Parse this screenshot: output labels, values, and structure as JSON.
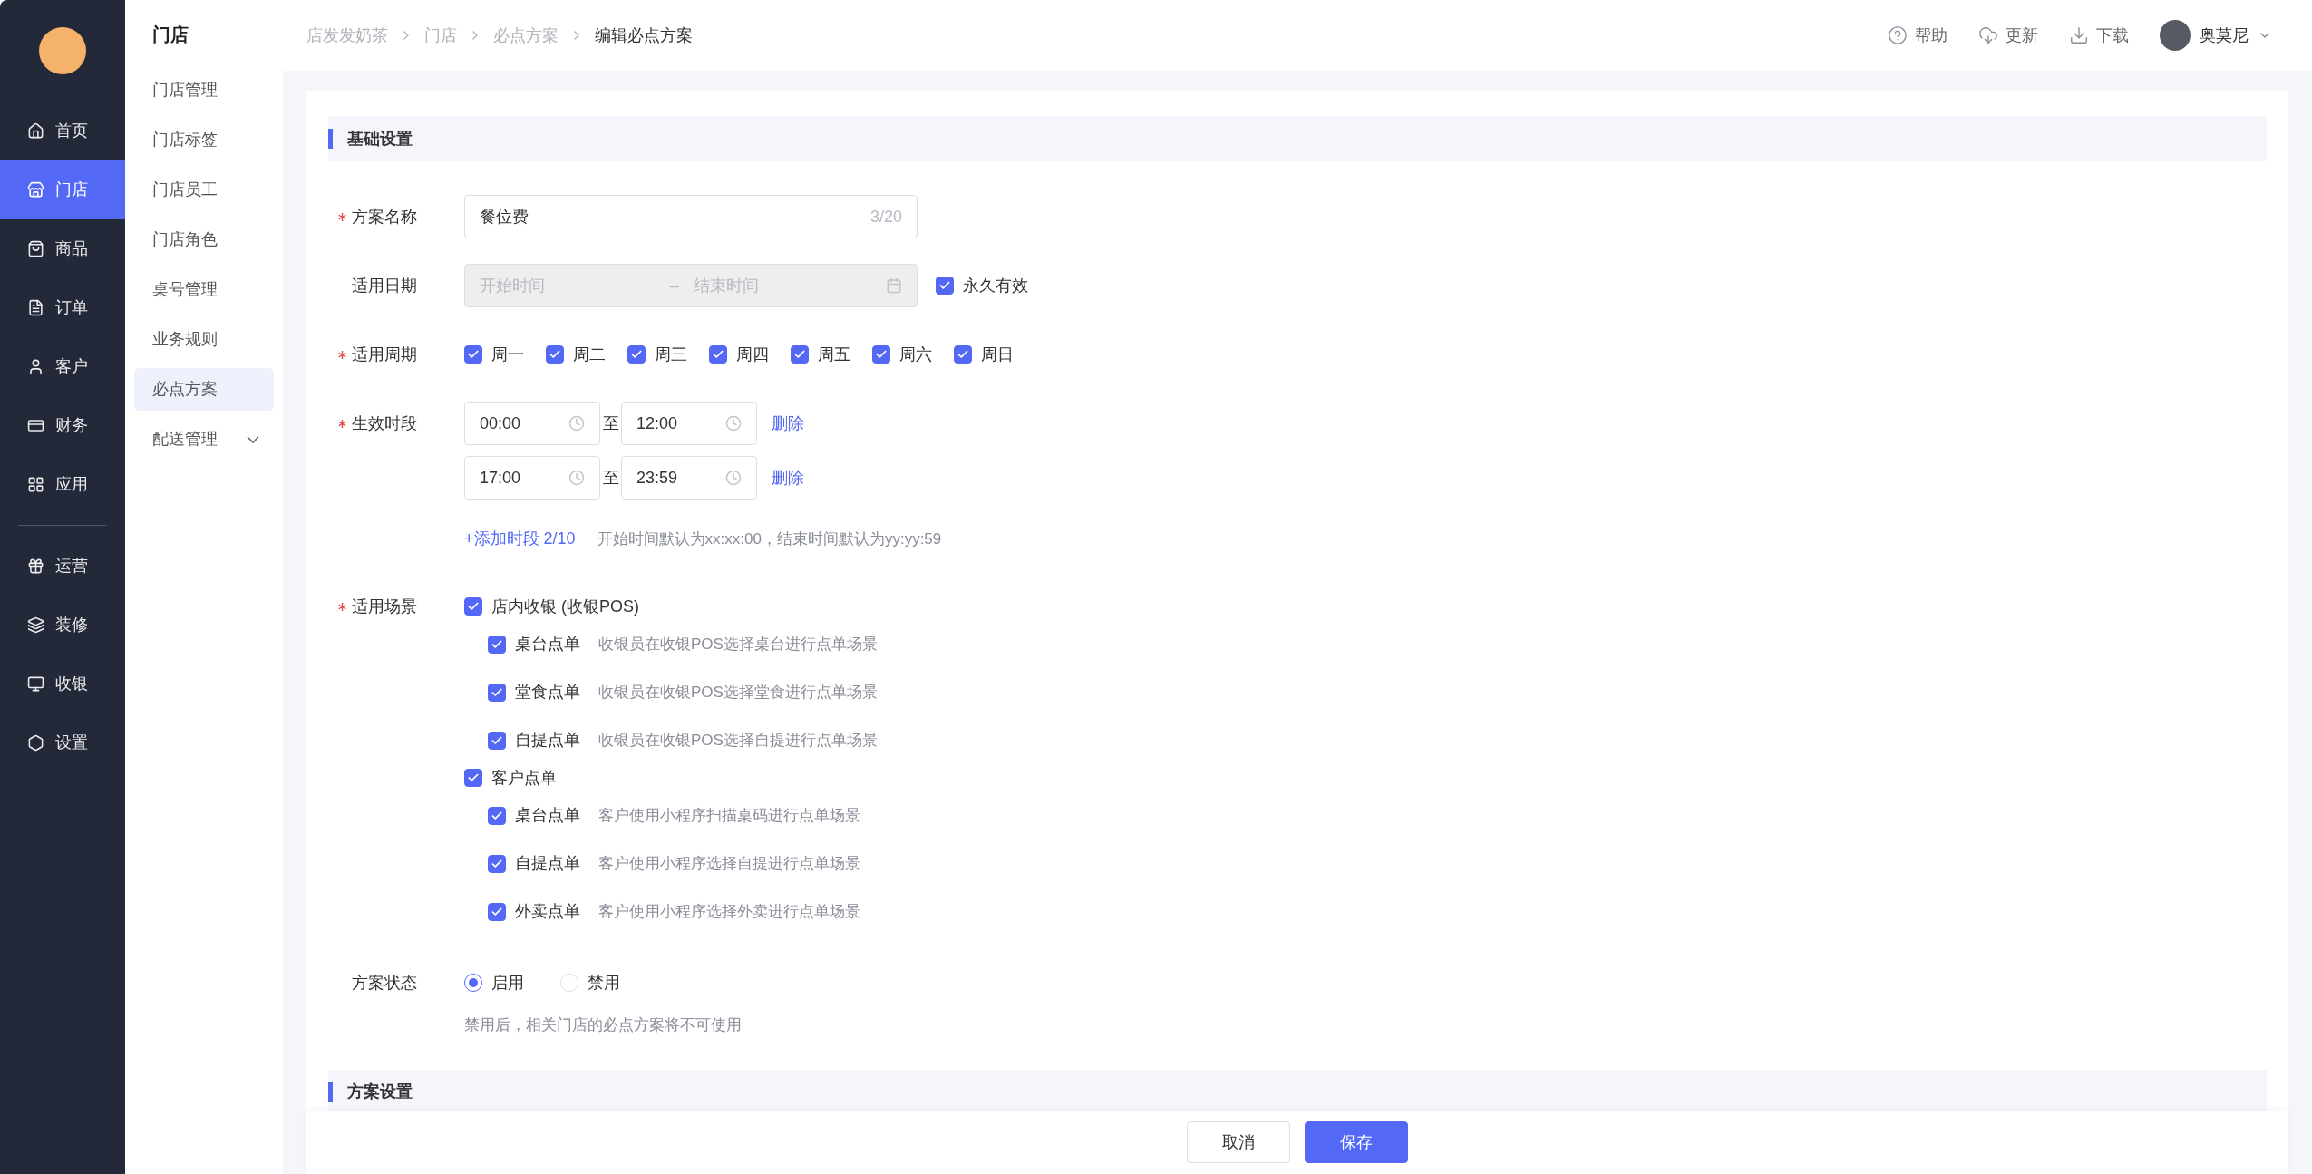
{
  "sidebar": {
    "main_items": [
      {
        "label": "首页",
        "selected": false
      },
      {
        "label": "门店",
        "selected": true
      },
      {
        "label": "商品",
        "selected": false
      },
      {
        "label": "订单",
        "selected": false
      },
      {
        "label": "客户",
        "selected": false
      },
      {
        "label": "财务",
        "selected": false
      },
      {
        "label": "应用",
        "selected": false
      }
    ],
    "tool_items": [
      {
        "label": "运营",
        "selected": false
      },
      {
        "label": "装修",
        "selected": false
      },
      {
        "label": "收银",
        "selected": false
      },
      {
        "label": "设置",
        "selected": false
      }
    ]
  },
  "submenu": {
    "title": "门店",
    "items": [
      {
        "label": "门店管理",
        "selected": false,
        "has_children": false
      },
      {
        "label": "门店标签",
        "selected": false,
        "has_children": false
      },
      {
        "label": "门店员工",
        "selected": false,
        "has_children": false
      },
      {
        "label": "门店角色",
        "selected": false,
        "has_children": false
      },
      {
        "label": "桌号管理",
        "selected": false,
        "has_children": false
      },
      {
        "label": "业务规则",
        "selected": false,
        "has_children": false
      },
      {
        "label": "必点方案",
        "selected": true,
        "has_children": false
      },
      {
        "label": "配送管理",
        "selected": false,
        "has_children": true
      }
    ]
  },
  "topbar": {
    "breadcrumb": [
      "店发发奶茶",
      "门店",
      "必点方案",
      "编辑必点方案"
    ],
    "actions": [
      {
        "label": "帮助"
      },
      {
        "label": "更新"
      },
      {
        "label": "下载"
      }
    ],
    "user": {
      "name": "奥莫尼"
    }
  },
  "sections": [
    {
      "title": "基础设置",
      "fields": [
        {
          "kind": "text",
          "label": "方案名称",
          "required": true,
          "value": "餐位费",
          "counter": "3/20"
        },
        {
          "kind": "daterange",
          "label": "适用日期",
          "required": false,
          "disabled": true,
          "start_placeholder": "开始时间",
          "separator": "–",
          "end_placeholder": "结束时间",
          "option": {
            "label": "永久有效",
            "checked": true
          }
        },
        {
          "kind": "checkboxes",
          "label": "适用周期",
          "required": true,
          "options": [
            {
              "label": "周一",
              "checked": true
            },
            {
              "label": "周二",
              "checked": true
            },
            {
              "label": "周三",
              "checked": true
            },
            {
              "label": "周四",
              "checked": true
            },
            {
              "label": "周五",
              "checked": true
            },
            {
              "label": "周六",
              "checked": true
            },
            {
              "label": "周日",
              "checked": true
            }
          ]
        },
        {
          "kind": "timeslots",
          "label": "生效时段",
          "required": true,
          "slots": [
            {
              "start": "00:00",
              "separator": "至",
              "end": "12:00",
              "delete": "删除"
            },
            {
              "start": "17:00",
              "separator": "至",
              "end": "23:59",
              "delete": "删除"
            }
          ],
          "add_link": "+添加时段 2/10",
          "hint": "开始时间默认为xx:xx:00，结束时间默认为yy:yy:59"
        },
        {
          "kind": "scenes",
          "label": "适用场景",
          "required": true,
          "groups": [
            {
              "label": "店内收银 (收银POS)",
              "checked": true,
              "children": [
                {
                  "label": "桌台点单",
                  "checked": true,
                  "description": "收银员在收银POS选择桌台进行点单场景"
                },
                {
                  "label": "堂食点单",
                  "checked": true,
                  "description": "收银员在收银POS选择堂食进行点单场景"
                },
                {
                  "label": "自提点单",
                  "checked": true,
                  "description": "收银员在收银POS选择自提进行点单场景"
                }
              ]
            },
            {
              "label": "客户点单",
              "checked": true,
              "children": [
                {
                  "label": "桌台点单",
                  "checked": true,
                  "description": "客户使用小程序扫描桌码进行点单场景"
                },
                {
                  "label": "自提点单",
                  "checked": true,
                  "description": "客户使用小程序选择自提进行点单场景"
                },
                {
                  "label": "外卖点单",
                  "checked": true,
                  "description": "客户使用小程序选择外卖进行点单场景"
                }
              ]
            }
          ]
        },
        {
          "kind": "radio",
          "label": "方案状态",
          "required": false,
          "options": [
            {
              "label": "启用",
              "selected": true
            },
            {
              "label": "禁用",
              "selected": false
            }
          ],
          "hint": "禁用后，相关门店的必点方案将不可使用"
        }
      ]
    },
    {
      "title": "方案设置"
    }
  ],
  "footer": {
    "buttons": [
      {
        "label": "取消",
        "kind": "default"
      },
      {
        "label": "保存",
        "kind": "primary"
      }
    ]
  }
}
